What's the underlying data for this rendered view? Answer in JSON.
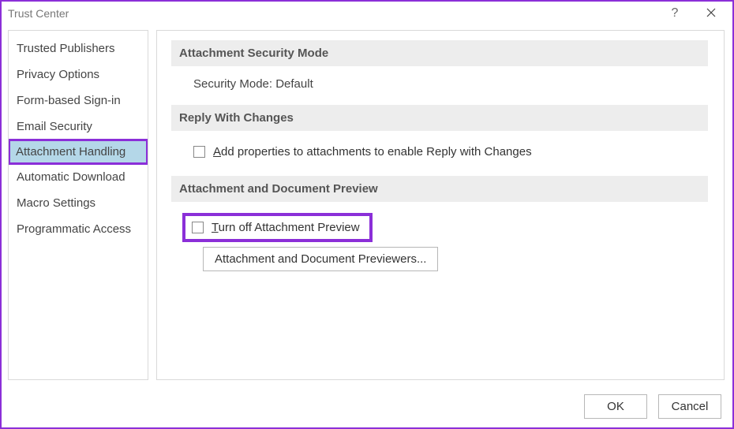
{
  "window": {
    "title": "Trust Center"
  },
  "sidebar": {
    "items": [
      {
        "label": "Trusted Publishers"
      },
      {
        "label": "Privacy Options"
      },
      {
        "label": "Form-based Sign-in"
      },
      {
        "label": "Email Security"
      },
      {
        "label": "Attachment Handling",
        "selected": true
      },
      {
        "label": "Automatic Download"
      },
      {
        "label": "Macro Settings"
      },
      {
        "label": "Programmatic Access"
      }
    ]
  },
  "sections": {
    "attachment_security": {
      "header": "Attachment Security Mode",
      "mode_label": "Security Mode: Default"
    },
    "reply_with_changes": {
      "header": "Reply With Changes",
      "checkbox_prefix": "A",
      "checkbox_rest": "dd properties to attachments to enable Reply with Changes"
    },
    "preview": {
      "header": "Attachment and Document Preview",
      "turnoff_prefix": "T",
      "turnoff_rest": "urn off Attachment Preview",
      "previewers_before": "Attachment and Document ",
      "previewers_ul": "P",
      "previewers_after": "reviewers..."
    }
  },
  "footer": {
    "ok": "OK",
    "cancel": "Cancel"
  }
}
